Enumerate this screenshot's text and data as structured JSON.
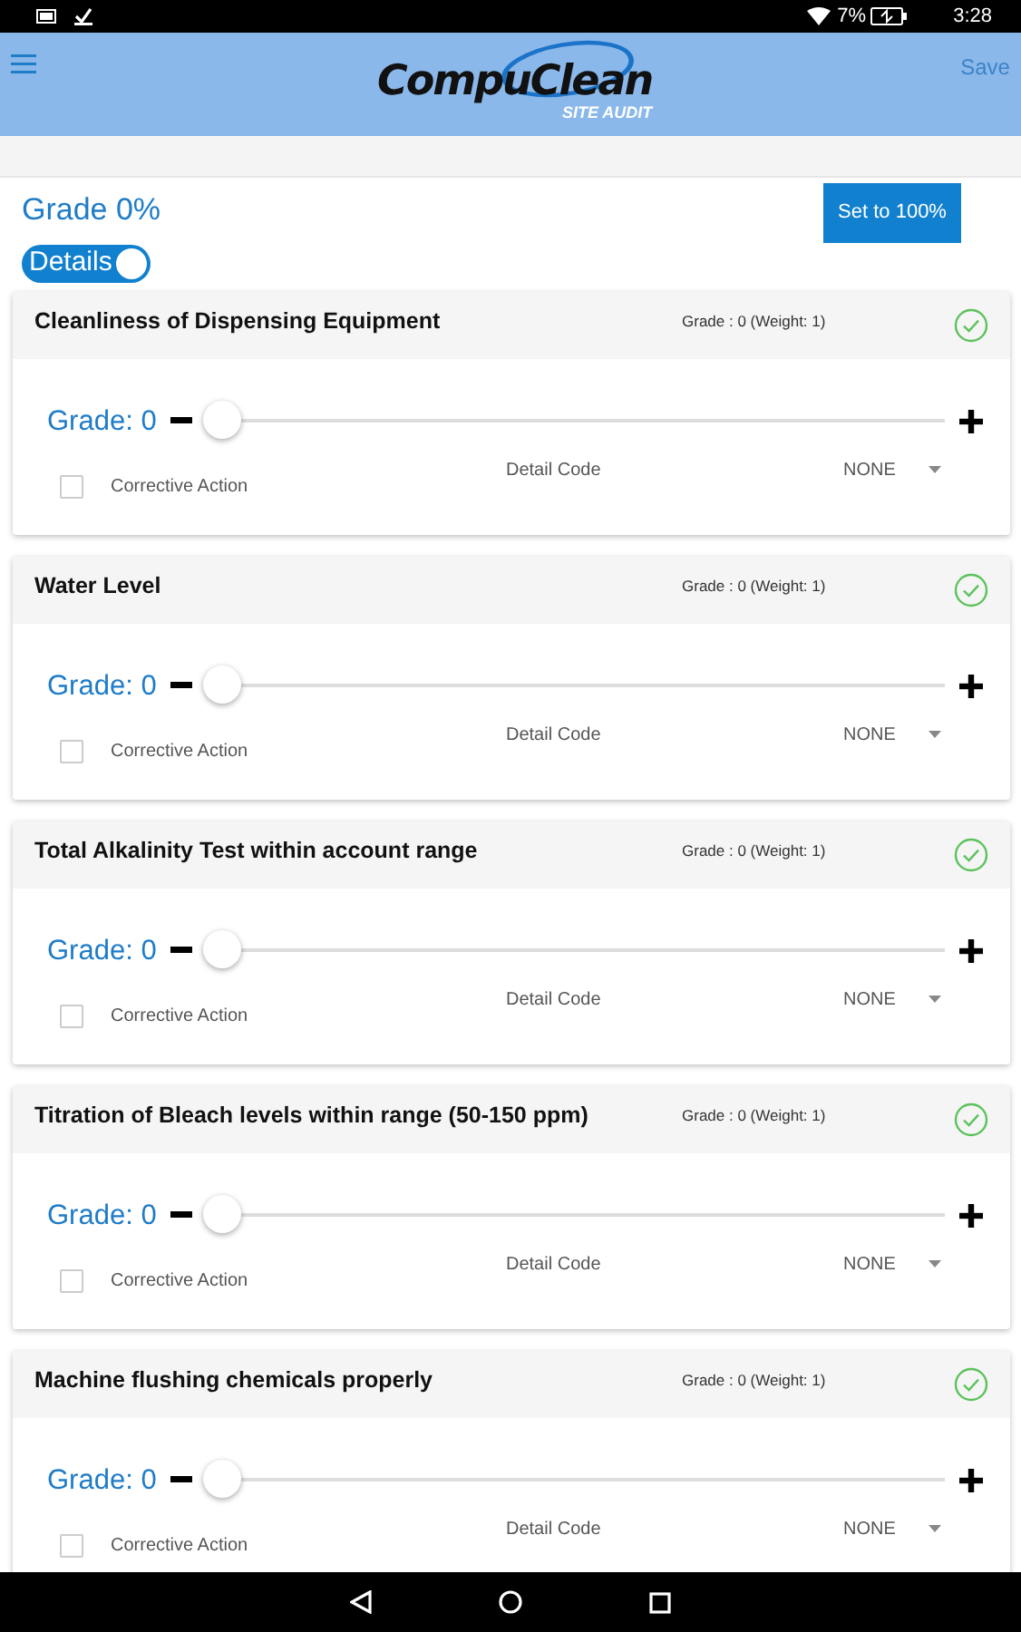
{
  "status_bar": {
    "battery": "7%",
    "time": "3:28"
  },
  "header": {
    "logo": "CompuClean",
    "logo_sub": "SITE AUDIT",
    "save": "Save"
  },
  "summary": {
    "grade": "Grade 0%",
    "set_button": "Set to 100%",
    "details_toggle": {
      "label": "Details",
      "on": true
    }
  },
  "items": [
    {
      "title": "Cleanliness of Dispensing Equipment",
      "grade_weight": "Grade : 0 (Weight: 1)",
      "grade_label": "Grade: 0",
      "level": 0,
      "corrective_action": {
        "label": "Corrective Action",
        "checked": false
      },
      "detail_code_label": "Detail Code",
      "detail_code_value": "NONE"
    },
    {
      "title": "Water Level",
      "grade_weight": "Grade : 0 (Weight: 1)",
      "grade_label": "Grade: 0",
      "level": 0,
      "corrective_action": {
        "label": "Corrective Action",
        "checked": false
      },
      "detail_code_label": "Detail Code",
      "detail_code_value": "NONE"
    },
    {
      "title": "Total Alkalinity Test within account range",
      "grade_weight": "Grade : 0 (Weight: 1)",
      "grade_label": "Grade: 0",
      "level": 0,
      "corrective_action": {
        "label": "Corrective Action",
        "checked": false
      },
      "detail_code_label": "Detail Code",
      "detail_code_value": "NONE"
    },
    {
      "title": "Titration of Bleach levels within range (50-150 ppm)",
      "grade_weight": "Grade : 0 (Weight: 1)",
      "grade_label": "Grade: 0",
      "level": 0,
      "corrective_action": {
        "label": "Corrective Action",
        "checked": false
      },
      "detail_code_label": "Detail Code",
      "detail_code_value": "NONE"
    },
    {
      "title": "Machine flushing chemicals properly",
      "grade_weight": "Grade : 0 (Weight: 1)",
      "grade_label": "Grade: 0",
      "level": 0,
      "corrective_action": {
        "label": "Corrective Action",
        "checked": false
      },
      "detail_code_label": "Detail Code",
      "detail_code_value": "NONE"
    }
  ]
}
